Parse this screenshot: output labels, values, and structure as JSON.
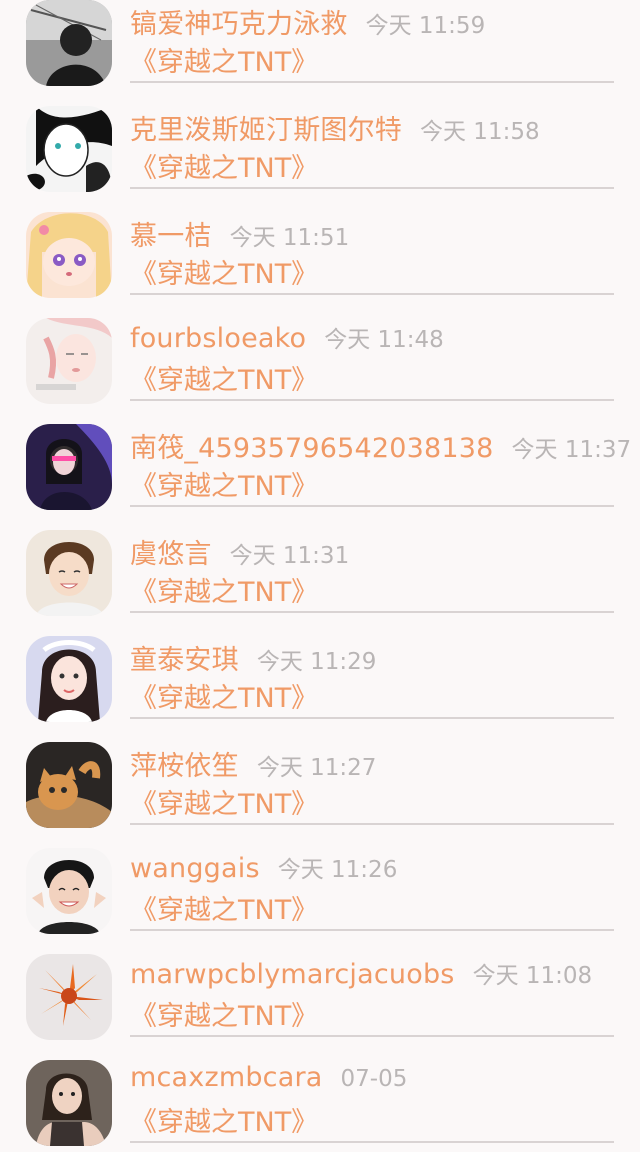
{
  "colors": {
    "accent": "#f09a66",
    "time": "#b9b5b5",
    "divider": "#d9d3d3",
    "background": "#fbf8f8"
  },
  "entries": [
    {
      "name": "镐爱神巧克力泳救",
      "time": "今天 11:59",
      "message": "《穿越之TNT》",
      "avatar": "bw-portrait-avatar"
    },
    {
      "name": "克里泼斯姬汀斯图尔特",
      "time": "今天 11:58",
      "message": "《穿越之TNT》",
      "avatar": "sketch-portrait-avatar"
    },
    {
      "name": "慕一桔",
      "time": "今天 11:51",
      "message": "《穿越之TNT》",
      "avatar": "anime-girl-avatar"
    },
    {
      "name": "fourbsloeako",
      "time": "今天 11:48",
      "message": "《穿越之TNT》",
      "avatar": "pale-portrait-avatar"
    },
    {
      "name": "南筏_45935796542038138",
      "time": "今天 11:37",
      "message": "《穿越之TNT》",
      "avatar": "neon-portrait-avatar"
    },
    {
      "name": "虞悠言",
      "time": "今天 11:31",
      "message": "《穿越之TNT》",
      "avatar": "smiling-boy-avatar"
    },
    {
      "name": "童泰安琪",
      "time": "今天 11:29",
      "message": "《穿越之TNT》",
      "avatar": "girl-portrait-avatar"
    },
    {
      "name": "萍桉依笙",
      "time": "今天 11:27",
      "message": "《穿越之TNT》",
      "avatar": "cat-avatar"
    },
    {
      "name": "wanggais",
      "time": "今天 11:26",
      "message": "《穿越之TNT》",
      "avatar": "boy-peace-sign-avatar"
    },
    {
      "name": "marwpcblymarcjacuobs",
      "time": "今天 11:08",
      "message": "《穿越之TNT》",
      "avatar": "orange-flower-avatar"
    },
    {
      "name": "mcaxzmbcara",
      "time": "07-05",
      "message": "《穿越之TNT》",
      "avatar": "sitting-girl-avatar"
    }
  ]
}
